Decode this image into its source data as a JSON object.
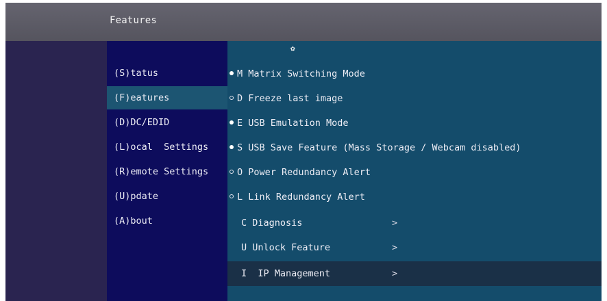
{
  "header": {
    "title": "Features"
  },
  "menu": {
    "items": [
      {
        "label": "(S)tatus"
      },
      {
        "label": "(F)eatures"
      },
      {
        "label": "(D)DC/EDID"
      },
      {
        "label": "(L)ocal  Settings"
      },
      {
        "label": "(R)emote Settings"
      },
      {
        "label": "(U)pdate"
      },
      {
        "label": "(A)bout"
      }
    ],
    "selected": "(F)eatures"
  },
  "content": {
    "scroll_indicator": "✿",
    "features": [
      {
        "label": "M Matrix Switching Mode",
        "enabled": true
      },
      {
        "label": "D Freeze last image",
        "enabled": false
      },
      {
        "label": "E USB Emulation Mode",
        "enabled": true
      },
      {
        "label": "S USB Save Feature (Mass Storage / Webcam disabled)",
        "enabled": true
      },
      {
        "label": "O Power Redundancy Alert",
        "enabled": false
      },
      {
        "label": "L Link Redundancy Alert",
        "enabled": false
      }
    ],
    "submenus": [
      {
        "label": "C Diagnosis",
        "arrow": ">"
      },
      {
        "label": "U Unlock Feature",
        "arrow": ">"
      },
      {
        "label": "I  IP Management",
        "arrow": ">"
      }
    ],
    "selected_submenu": "I  IP Management"
  },
  "colors": {
    "title_bar": "#5c5b66",
    "menu_bg": "#0d0c5c",
    "menu_selected": "#1c5572",
    "content_bg": "#144c6b",
    "row_selected": "#1a3047"
  }
}
